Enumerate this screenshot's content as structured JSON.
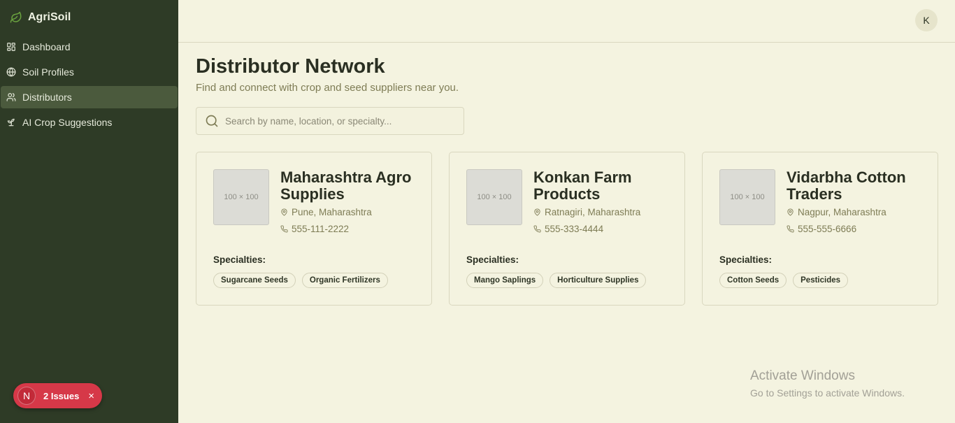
{
  "app": {
    "name": "AgriSoil"
  },
  "sidebar": {
    "items": [
      {
        "label": "Dashboard",
        "icon": "dashboard-icon",
        "active": false
      },
      {
        "label": "Soil Profiles",
        "icon": "globe-icon",
        "active": false
      },
      {
        "label": "Distributors",
        "icon": "users-icon",
        "active": true
      },
      {
        "label": "AI Crop Suggestions",
        "icon": "sprout-icon",
        "active": false
      }
    ]
  },
  "issues_badge": {
    "avatar_letter": "N",
    "label": "2 Issues",
    "close": "×"
  },
  "header": {
    "avatar_initial": "K"
  },
  "page": {
    "title": "Distributor Network",
    "subtitle": "Find and connect with crop and seed suppliers near you."
  },
  "search": {
    "placeholder": "Search by name, location, or specialty...",
    "value": ""
  },
  "distributors": [
    {
      "image_placeholder": "100 × 100",
      "name": "Maharashtra Agro Supplies",
      "location": "Pune, Maharashtra",
      "phone": "555-111-2222",
      "specialties_label": "Specialties:",
      "specialties": [
        "Sugarcane Seeds",
        "Organic Fertilizers"
      ]
    },
    {
      "image_placeholder": "100 × 100",
      "name": "Konkan Farm Products",
      "location": "Ratnagiri, Maharashtra",
      "phone": "555-333-4444",
      "specialties_label": "Specialties:",
      "specialties": [
        "Mango Saplings",
        "Horticulture Supplies"
      ]
    },
    {
      "image_placeholder": "100 × 100",
      "name": "Vidarbha Cotton Traders",
      "location": "Nagpur, Maharashtra",
      "phone": "555-555-6666",
      "specialties_label": "Specialties:",
      "specialties": [
        "Cotton Seeds",
        "Pesticides"
      ]
    }
  ],
  "watermark": {
    "title": "Activate Windows",
    "subtitle": "Go to Settings to activate Windows."
  },
  "colors": {
    "sidebar_bg": "#2e3b26",
    "sidebar_active": "#4b5a3d",
    "page_bg": "#f4f3e0",
    "accent_green": "#5e8f3a",
    "issues_red": "#d63848"
  }
}
